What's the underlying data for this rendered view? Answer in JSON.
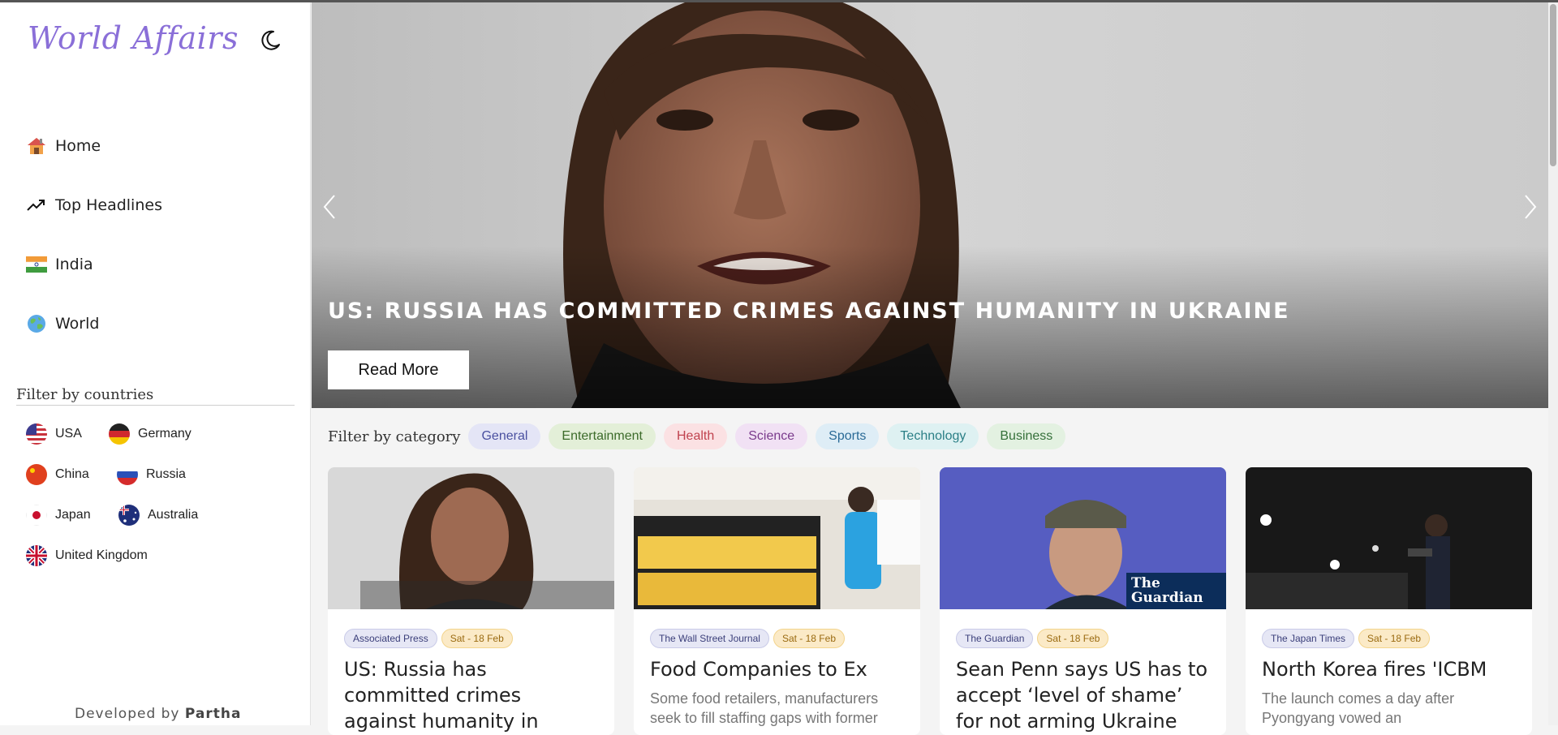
{
  "app": {
    "logo_text": "World Affairs"
  },
  "nav": [
    {
      "label": "Home",
      "icon": "home-icon"
    },
    {
      "label": "Top Headlines",
      "icon": "trending-up-icon"
    },
    {
      "label": "India",
      "icon": "india-flag-icon"
    },
    {
      "label": "World",
      "icon": "globe-icon"
    }
  ],
  "countries": {
    "title": "Filter by countries",
    "items": [
      "USA",
      "Germany",
      "China",
      "Russia",
      "Japan",
      "Australia",
      "United Kingdom"
    ]
  },
  "footer": {
    "prefix": "Developed by",
    "author": "Partha"
  },
  "hero": {
    "title": "US: RUSSIA HAS COMMITTED CRIMES AGAINST HUMANITY IN UKRAINE",
    "button": "Read More"
  },
  "categories": {
    "label": "Filter by category",
    "items": [
      {
        "name": "General",
        "bg": "#e4e5f6",
        "fg": "#4a50a0"
      },
      {
        "name": "Entertainment",
        "bg": "#e3efd8",
        "fg": "#3c6b2a"
      },
      {
        "name": "Health",
        "bg": "#fbe1e3",
        "fg": "#c0424e"
      },
      {
        "name": "Science",
        "bg": "#f1e1f4",
        "fg": "#7a3a8c"
      },
      {
        "name": "Sports",
        "bg": "#deedf6",
        "fg": "#2a6a96"
      },
      {
        "name": "Technology",
        "bg": "#def1f2",
        "fg": "#2b7f86"
      },
      {
        "name": "Business",
        "bg": "#e3f1e1",
        "fg": "#35703a"
      }
    ]
  },
  "cards": [
    {
      "source": "Associated Press",
      "date": "Sat - 18 Feb",
      "title": "US: Russia has committed crimes against humanity in Ukraine",
      "desc": ""
    },
    {
      "source": "The Wall Street Journal",
      "date": "Sat - 18 Feb",
      "title": "Food Companies to Ex",
      "desc": "Some food retailers, manufacturers seek to fill staffing gaps with former"
    },
    {
      "source": "The Guardian",
      "date": "Sat - 18 Feb",
      "title": "Sean Penn says US has to accept ‘level of shame’ for not arming Ukraine faster",
      "desc": ""
    },
    {
      "source": "The Japan Times",
      "date": "Sat - 18 Feb",
      "title": "North Korea fires 'ICBM",
      "desc": "The launch comes a day after Pyongyang vowed an"
    }
  ],
  "guardian_logo": "The Guardian",
  "colors": {
    "logo": "#8a6fd8",
    "sidebar_bg": "#ffffff",
    "page_bg": "#f4f4f4"
  }
}
